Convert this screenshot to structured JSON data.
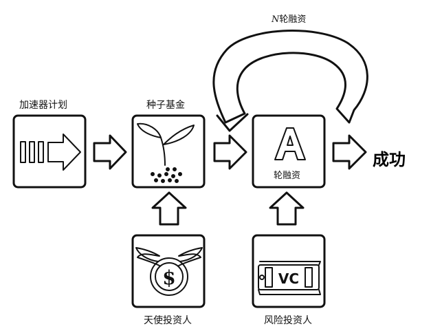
{
  "labels": {
    "accelerator": "加速器计划",
    "seed_fund": "种子基金",
    "round_box_letter": "A",
    "round_box_label": "轮融资",
    "n_round_prefix": "N",
    "n_round_suffix": "轮融资",
    "success": "成功",
    "angel_investor": "天使投资人",
    "venture_investor": "风险投资人",
    "vc_bill_text": "VC"
  },
  "icons": {
    "accelerator": "speed-lines-arrow-icon",
    "seed": "sprout-seeds-icon",
    "round_a": "letter-a-icon",
    "angel": "winged-dollar-coin-icon",
    "vc": "vc-money-bills-icon"
  }
}
